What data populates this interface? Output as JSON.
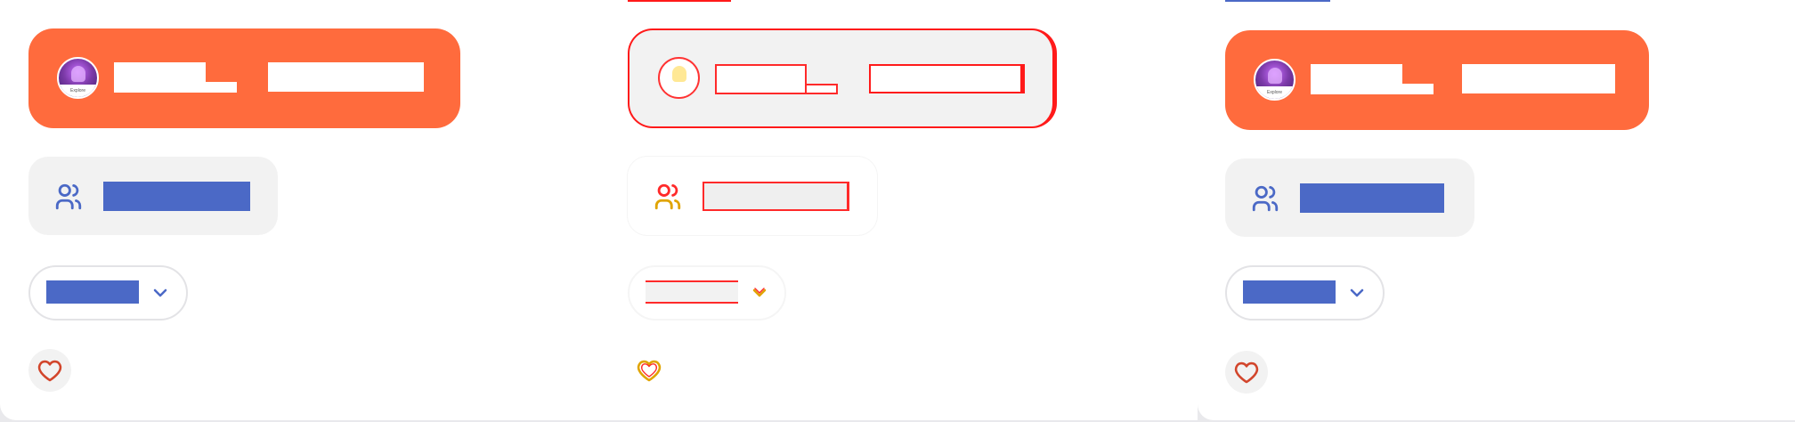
{
  "colors": {
    "accent": "#ff6b3d",
    "primary_blue": "#4b69c6",
    "pill_background": "#f2f2f2",
    "outline_red": "#ff1a1a"
  },
  "panels": [
    {
      "variant": "default",
      "profile": {
        "name": "",
        "role": "",
        "avatar_caption": "Explore"
      },
      "team": {
        "icon": "users-icon",
        "label": ""
      },
      "dropdown": {
        "label": "",
        "icon": "chevron-down-icon"
      },
      "favorite": {
        "icon": "heart-icon"
      }
    },
    {
      "variant": "outlined",
      "profile": {
        "name": "",
        "role": "",
        "avatar_caption": ""
      },
      "team": {
        "icon": "users-icon",
        "label": ""
      },
      "dropdown": {
        "label": "",
        "icon": "chevron-down-icon"
      },
      "favorite": {
        "icon": "heart-icon"
      }
    },
    {
      "variant": "default",
      "profile": {
        "name": "",
        "role": "",
        "avatar_caption": "Explore"
      },
      "team": {
        "icon": "users-icon",
        "label": ""
      },
      "dropdown": {
        "label": "",
        "icon": "chevron-down-icon"
      },
      "favorite": {
        "icon": "heart-icon"
      }
    }
  ]
}
